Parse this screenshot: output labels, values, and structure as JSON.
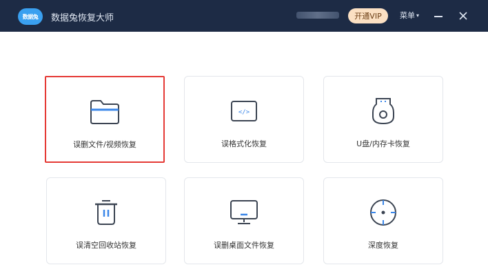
{
  "app": {
    "logo_text": "数据兔",
    "title": "数据兔恢复大师"
  },
  "titlebar": {
    "vip_label": "开通VIP",
    "menu_label": "菜单",
    "menu_caret": "▾"
  },
  "cards": [
    {
      "label": "误删文件/视频恢复",
      "icon": "folder-icon"
    },
    {
      "label": "误格式化恢复",
      "icon": "code-window-icon"
    },
    {
      "label": "U盘/内存卡恢复",
      "icon": "usb-drive-icon"
    },
    {
      "label": "误清空回收站恢复",
      "icon": "trash-icon"
    },
    {
      "label": "误删桌面文件恢复",
      "icon": "monitor-icon"
    },
    {
      "label": "深度恢复",
      "icon": "target-icon"
    }
  ],
  "colors": {
    "titlebar_bg": "#1d2b45",
    "accent": "#3a86e8",
    "icon_stroke": "#3b4452",
    "selected_border": "#e53935",
    "vip_bg": "#fbe0c3"
  }
}
